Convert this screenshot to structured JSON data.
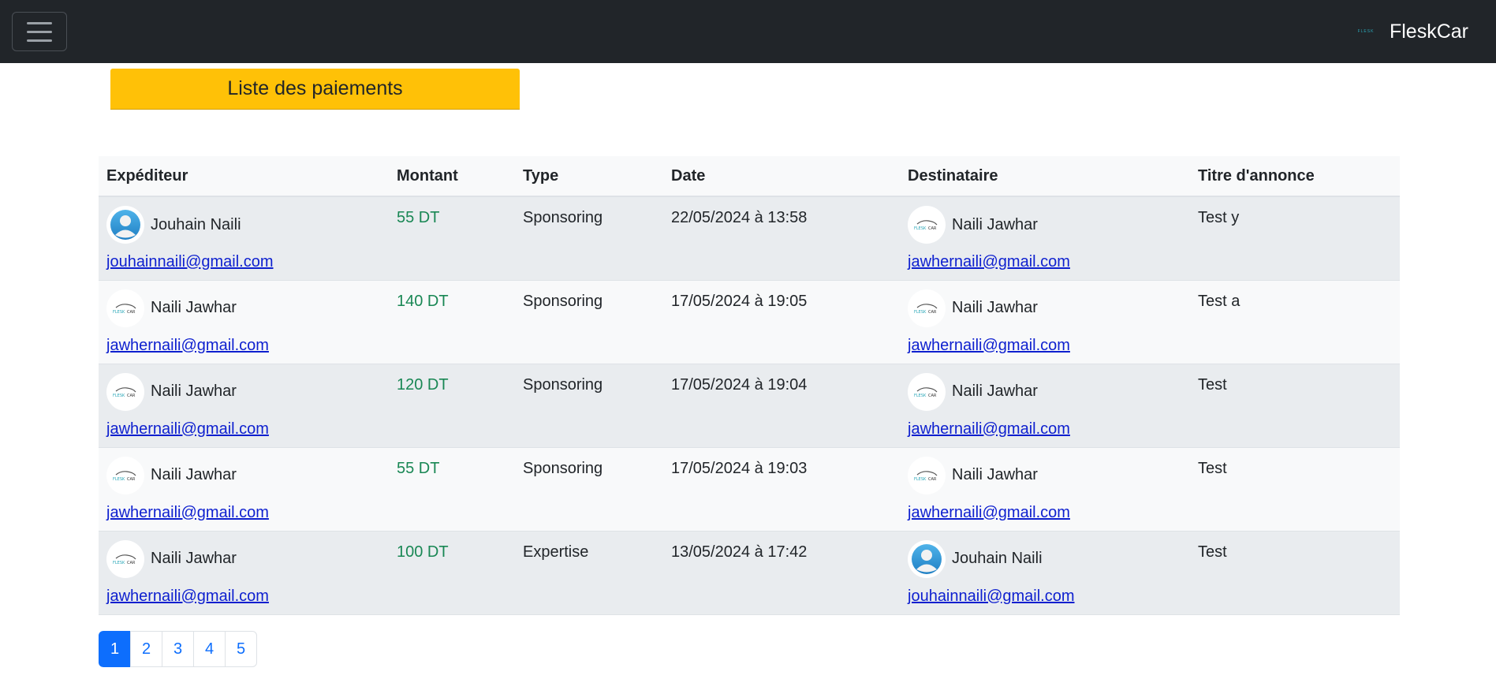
{
  "navbar": {
    "brand_name": "FleskCar",
    "brand_logo_text": "FLESK"
  },
  "page": {
    "title": "Liste des paiements"
  },
  "table": {
    "headers": [
      "Expéditeur",
      "Montant",
      "Type",
      "Date",
      "Destinataire",
      "Titre d'annonce"
    ],
    "rows": [
      {
        "sender": {
          "name": "Jouhain Naili",
          "email": "jouhainnaili@gmail.com",
          "avatar": "user-avatar-icon"
        },
        "amount": "55 DT",
        "type": "Sponsoring",
        "date": "22/05/2024 à 13:58",
        "recipient": {
          "name": "Naili Jawhar",
          "email": "jawhernaili@gmail.com",
          "avatar": "fleskcar-logo"
        },
        "title": "Test y"
      },
      {
        "sender": {
          "name": "Naili Jawhar",
          "email": "jawhernaili@gmail.com",
          "avatar": "fleskcar-logo"
        },
        "amount": "140 DT",
        "type": "Sponsoring",
        "date": "17/05/2024 à 19:05",
        "recipient": {
          "name": "Naili Jawhar",
          "email": "jawhernaili@gmail.com",
          "avatar": "fleskcar-logo"
        },
        "title": "Test a"
      },
      {
        "sender": {
          "name": "Naili Jawhar",
          "email": "jawhernaili@gmail.com",
          "avatar": "fleskcar-logo"
        },
        "amount": "120 DT",
        "type": "Sponsoring",
        "date": "17/05/2024 à 19:04",
        "recipient": {
          "name": "Naili Jawhar",
          "email": "jawhernaili@gmail.com",
          "avatar": "fleskcar-logo"
        },
        "title": "Test"
      },
      {
        "sender": {
          "name": "Naili Jawhar",
          "email": "jawhernaili@gmail.com",
          "avatar": "fleskcar-logo"
        },
        "amount": "55 DT",
        "type": "Sponsoring",
        "date": "17/05/2024 à 19:03",
        "recipient": {
          "name": "Naili Jawhar",
          "email": "jawhernaili@gmail.com",
          "avatar": "fleskcar-logo"
        },
        "title": "Test"
      },
      {
        "sender": {
          "name": "Naili Jawhar",
          "email": "jawhernaili@gmail.com",
          "avatar": "fleskcar-logo"
        },
        "amount": "100 DT",
        "type": "Expertise",
        "date": "13/05/2024 à 17:42",
        "recipient": {
          "name": "Jouhain Naili",
          "email": "jouhainnaili@gmail.com",
          "avatar": "user-avatar-icon"
        },
        "title": "Test"
      }
    ]
  },
  "pagination": {
    "pages": [
      "1",
      "2",
      "3",
      "4",
      "5"
    ],
    "active": "1"
  },
  "colors": {
    "navbar": "#212529",
    "banner": "#ffc107",
    "amount": "#198754",
    "link": "#0d1fcf",
    "active_page": "#0d6efd"
  }
}
